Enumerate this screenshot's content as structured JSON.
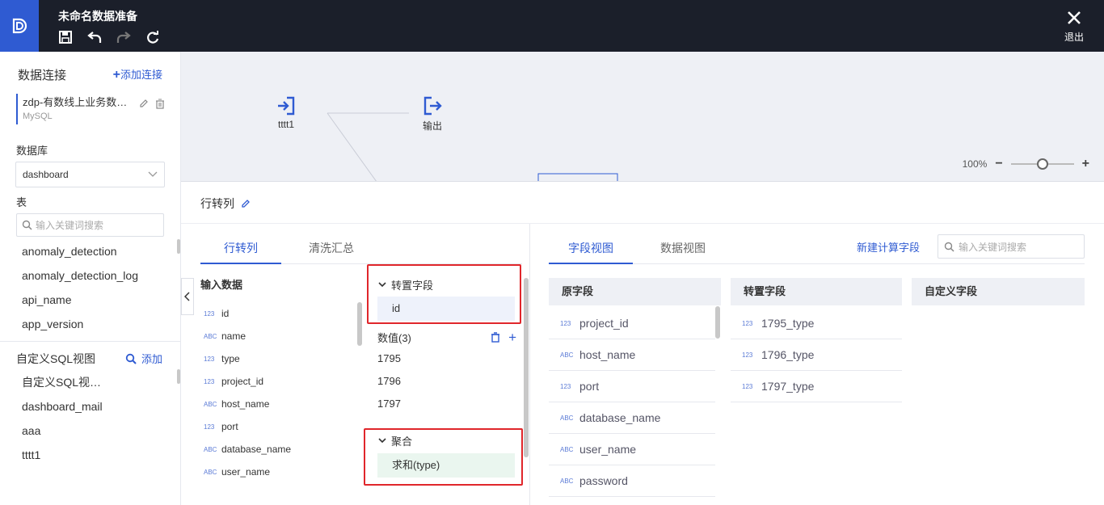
{
  "app": {
    "title": "未命名数据准备",
    "exit_label": "退出"
  },
  "sidebar": {
    "header": "数据连接",
    "add_connection": "添加连接",
    "connection": {
      "name": "zdp-有数线上业务数…",
      "type": "MySQL"
    },
    "db_label": "数据库",
    "db_selected": "dashboard",
    "table_label": "表",
    "search_placeholder": "输入关键词搜索",
    "tables": [
      "anomaly_detection",
      "anomaly_detection_log",
      "api_name",
      "app_version"
    ],
    "sql_header": "自定义SQL视图",
    "sql_add": "添加",
    "sql_views": [
      "自定义SQL视…",
      "dashboard_mail",
      "aaa",
      "tttt1"
    ]
  },
  "canvas": {
    "nodes": [
      {
        "label": "tttt1",
        "icon": "input-icon"
      },
      {
        "label": "输出",
        "icon": "output-icon"
      }
    ],
    "zoom_level": "100%",
    "zoom_fraction": 0.5
  },
  "panel": {
    "title": "行转列",
    "left_tabs": [
      "行转列",
      "清洗汇总"
    ],
    "input_title": "输入数据",
    "input_fields": [
      {
        "type": "123",
        "name": "id"
      },
      {
        "type": "ABC",
        "name": "name"
      },
      {
        "type": "123",
        "name": "type"
      },
      {
        "type": "123",
        "name": "project_id"
      },
      {
        "type": "ABC",
        "name": "host_name"
      },
      {
        "type": "123",
        "name": "port"
      },
      {
        "type": "ABC",
        "name": "database_name"
      },
      {
        "type": "ABC",
        "name": "user_name"
      }
    ],
    "pivot_section": "转置字段",
    "pivot_field": "id",
    "values_label": "数值(3)",
    "values": [
      "1795",
      "1796",
      "1797"
    ],
    "agg_section": "聚合",
    "agg_field": "求和(type)",
    "right_tabs": [
      "字段视图",
      "数据视图"
    ],
    "new_field": "新建计算字段",
    "right_search_placeholder": "输入关键词搜索",
    "col_original": "原字段",
    "col_pivot": "转置字段",
    "col_custom": "自定义字段",
    "original_fields": [
      {
        "type": "123",
        "name": "project_id"
      },
      {
        "type": "ABC",
        "name": "host_name"
      },
      {
        "type": "123",
        "name": "port"
      },
      {
        "type": "ABC",
        "name": "database_name"
      },
      {
        "type": "ABC",
        "name": "user_name"
      },
      {
        "type": "ABC",
        "name": "password"
      }
    ],
    "pivot_fields": [
      {
        "type": "123",
        "name": "1795_type"
      },
      {
        "type": "123",
        "name": "1796_type"
      },
      {
        "type": "123",
        "name": "1797_type"
      }
    ]
  },
  "colors": {
    "accent": "#2f5bd2",
    "highlight_box": "#e0262b",
    "topbar": "#1b1f2a"
  }
}
